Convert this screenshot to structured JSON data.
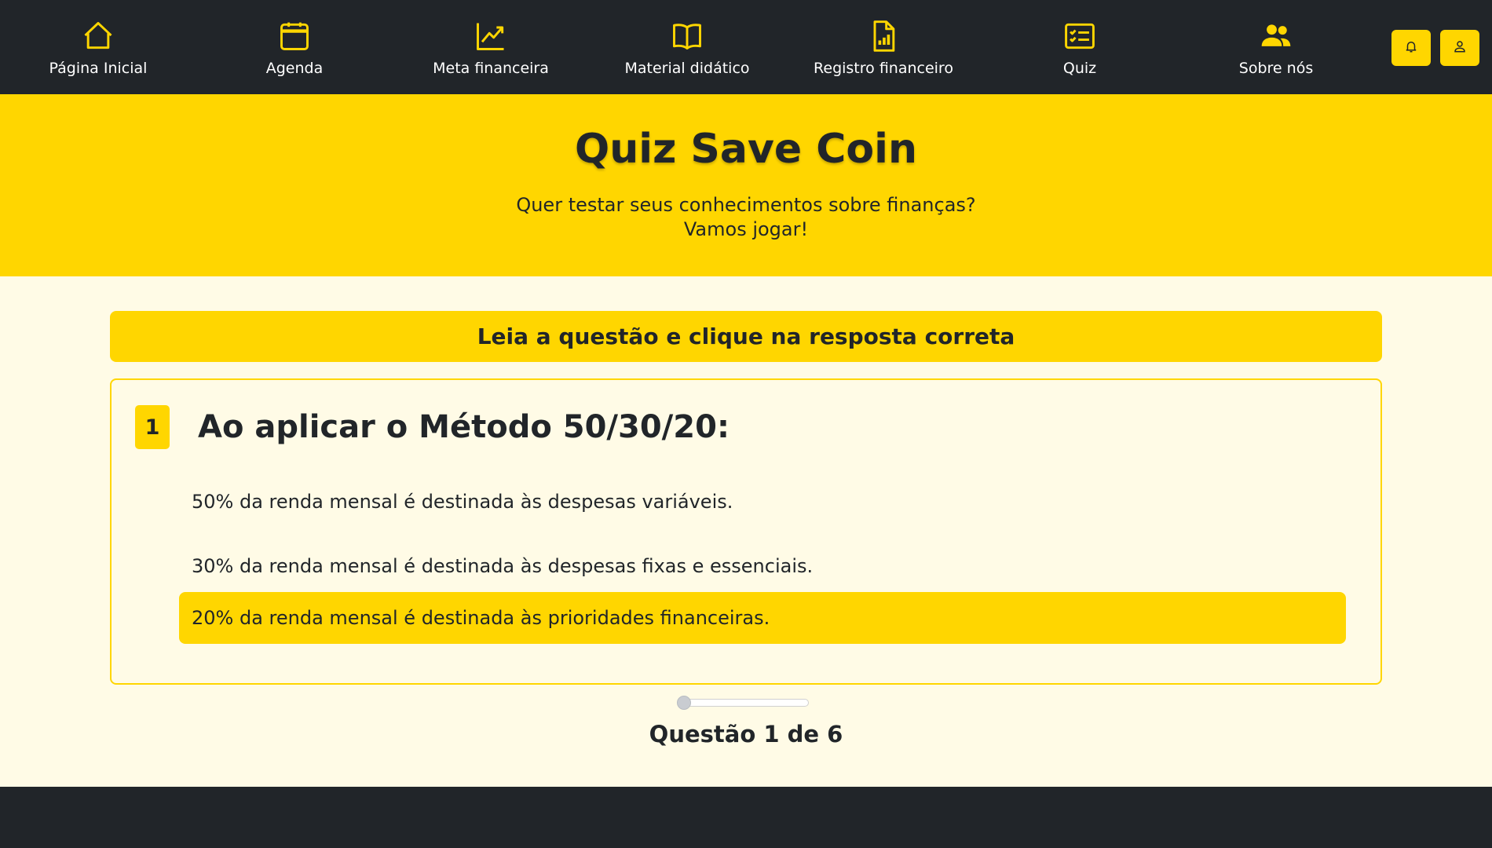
{
  "colors": {
    "accent": "#ffd600",
    "dark": "#212529",
    "background": "#fffbe6"
  },
  "nav": {
    "items": [
      {
        "label": "Página Inicial",
        "icon": "home-icon"
      },
      {
        "label": "Agenda",
        "icon": "calendar-icon"
      },
      {
        "label": "Meta financeira",
        "icon": "chart-line-icon"
      },
      {
        "label": "Material didático",
        "icon": "book-icon"
      },
      {
        "label": "Registro financeiro",
        "icon": "file-chart-icon"
      },
      {
        "label": "Quiz",
        "icon": "checklist-icon"
      },
      {
        "label": "Sobre nós",
        "icon": "people-icon"
      }
    ],
    "buttons": [
      {
        "icon": "bell-icon"
      },
      {
        "icon": "user-icon"
      }
    ]
  },
  "hero": {
    "title": "Quiz Save Coin",
    "subtitle_line1": "Quer testar seus conhecimentos sobre finanças?",
    "subtitle_line2": "Vamos jogar!"
  },
  "instruction": "Leia a questão e clique na resposta correta",
  "question": {
    "number": "1",
    "text": "Ao aplicar o Método 50/30/20:",
    "options": [
      "50% da renda mensal é destinada às despesas variáveis.",
      "30% da renda mensal é destinada às despesas fixas e essenciais.",
      "20% da renda mensal é destinada às prioridades financeiras."
    ],
    "selected_index": 2
  },
  "progress": {
    "label": "Questão 1 de 6",
    "fraction": 0
  }
}
